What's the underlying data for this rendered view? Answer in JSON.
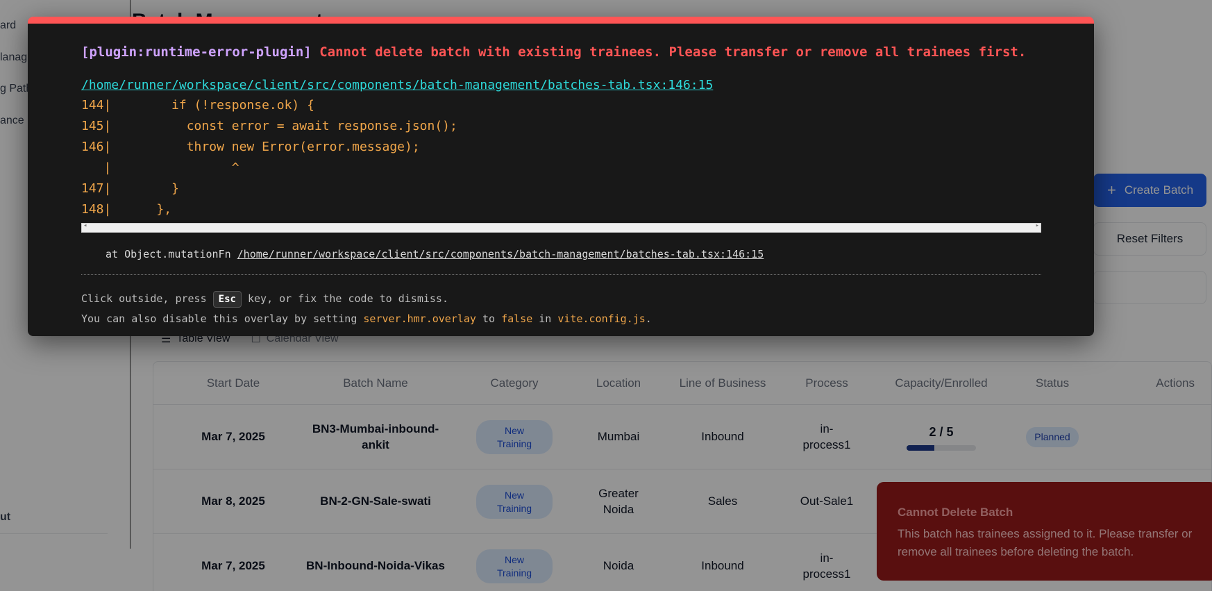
{
  "sidebar": {
    "items": [
      {
        "label": "ard",
        "top": 0
      },
      {
        "label": "lanag"
      },
      {
        "label": "g Path"
      },
      {
        "label": "ance"
      }
    ],
    "footer_item": "ut"
  },
  "main": {
    "page_title": "Batch Management",
    "create_button": "Create Batch",
    "reset_button": "Reset Filters",
    "view_tabs": [
      "Table View",
      "Calendar View"
    ]
  },
  "table": {
    "headers": [
      "Start Date",
      "Batch Name",
      "Category",
      "Location",
      "Line of Business",
      "Process",
      "Capacity/Enrolled",
      "Status",
      "Actions"
    ],
    "rows": [
      {
        "start_date": "Mar 7, 2025",
        "batch_name": "BN3-Mumbai-inbound-ankit",
        "category": "New Training",
        "location": "Mumbai",
        "lob": "Inbound",
        "process": "in-process1",
        "capacity": "2 / 5",
        "capacity_fraction": 0.4,
        "status": "Planned"
      },
      {
        "start_date": "Mar 8, 2025",
        "batch_name": "BN-2-GN-Sale-swati",
        "category": "New Training",
        "location": "Greater Noida",
        "lob": "Sales",
        "process": "Out-Sale1",
        "capacity": "",
        "status": ""
      },
      {
        "start_date": "Mar 7, 2025",
        "batch_name": "BN-Inbound-Noida-Vikas",
        "category": "New Training",
        "location": "Noida",
        "lob": "Inbound",
        "process": "in-process1",
        "capacity": "",
        "status": ""
      }
    ]
  },
  "toast": {
    "title": "Cannot Delete Batch",
    "description": "This batch has trainees assigned to it. Please transfer or remove all trainees before deleting the batch."
  },
  "overlay": {
    "plugin": "[plugin:runtime-error-plugin]",
    "message": "Cannot delete batch with existing trainees. Please transfer or remove all trainees first.",
    "file": "/home/runner/workspace/client/src/components/batch-management/batches-tab.tsx:146:15",
    "frame": "144|        if (!response.ok) {\n145|          const error = await response.json();\n146|          throw new Error(error.message);\n   |                ^\n147|        }\n148|      },",
    "stack_prefix": "at Object.mutationFn",
    "stack_file": "/home/runner/workspace/client/src/components/batch-management/batches-tab.tsx:146:15",
    "tip1_a": "Click outside, press",
    "tip1_key": "Esc",
    "tip1_b": "key, or fix the code to dismiss.",
    "tip2_a": "You can also disable this overlay by setting",
    "tip2_code1": "server.hmr.overlay",
    "tip2_b": "to",
    "tip2_code2": "false",
    "tip2_c": "in",
    "tip2_code3": "vite.config.js",
    "tip2_d": "."
  }
}
